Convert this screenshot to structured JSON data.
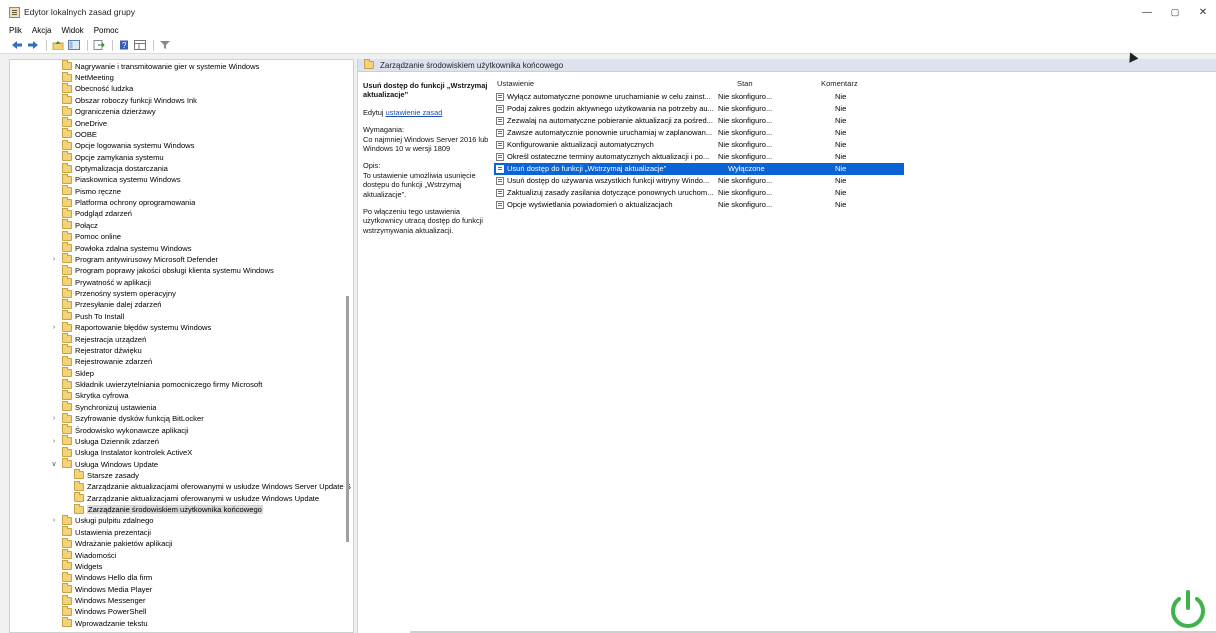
{
  "window": {
    "title": "Edytor lokalnych zasad grupy",
    "controls": [
      "—",
      "▢",
      "✕"
    ]
  },
  "menu": [
    "Plik",
    "Akcja",
    "Widok",
    "Pomoc"
  ],
  "toolbar": {
    "icons": [
      "back-icon",
      "forward-icon",
      "up-folder-icon",
      "show-hide-tree-icon",
      "export-list-icon",
      "help-icon",
      "view-icon",
      "filter-icon"
    ]
  },
  "tree": {
    "items": [
      {
        "label": "Nagrywanie i transmitowanie gier w systemie Windows",
        "level": 1,
        "expander": ""
      },
      {
        "label": "NetMeeting",
        "level": 1,
        "expander": ""
      },
      {
        "label": "Obecność ludzka",
        "level": 1,
        "expander": ""
      },
      {
        "label": "Obszar roboczy funkcji Windows Ink",
        "level": 1,
        "expander": ""
      },
      {
        "label": "Ograniczenia dzierżawy",
        "level": 1,
        "expander": ""
      },
      {
        "label": "OneDrive",
        "level": 1,
        "expander": ""
      },
      {
        "label": "OOBE",
        "level": 1,
        "expander": ""
      },
      {
        "label": "Opcje logowania systemu Windows",
        "level": 1,
        "expander": ""
      },
      {
        "label": "Opcje zamykania systemu",
        "level": 1,
        "expander": ""
      },
      {
        "label": "Optymalizacja dostarczania",
        "level": 1,
        "expander": ""
      },
      {
        "label": "Piaskownica systemu Windows",
        "level": 1,
        "expander": ""
      },
      {
        "label": "Pismo ręczne",
        "level": 1,
        "expander": ""
      },
      {
        "label": "Platforma ochrony oprogramowania",
        "level": 1,
        "expander": ""
      },
      {
        "label": "Podgląd zdarzeń",
        "level": 1,
        "expander": ""
      },
      {
        "label": "Połącz",
        "level": 1,
        "expander": ""
      },
      {
        "label": "Pomoc online",
        "level": 1,
        "expander": ""
      },
      {
        "label": "Powłoka zdalna systemu Windows",
        "level": 1,
        "expander": ""
      },
      {
        "label": "Program antywirusowy Microsoft Defender",
        "level": 1,
        "expander": ">"
      },
      {
        "label": "Program poprawy jakości obsługi klienta systemu Windows",
        "level": 1,
        "expander": ""
      },
      {
        "label": "Prywatność w aplikacji",
        "level": 1,
        "expander": ""
      },
      {
        "label": "Przenośny system operacyjny",
        "level": 1,
        "expander": ""
      },
      {
        "label": "Przesyłanie dalej zdarzeń",
        "level": 1,
        "expander": ""
      },
      {
        "label": "Push To Install",
        "level": 1,
        "expander": ""
      },
      {
        "label": "Raportowanie błędów systemu Windows",
        "level": 1,
        "expander": ">"
      },
      {
        "label": "Rejestracja urządzeń",
        "level": 1,
        "expander": ""
      },
      {
        "label": "Rejestrator dźwięku",
        "level": 1,
        "expander": ""
      },
      {
        "label": "Rejestrowanie zdarzeń",
        "level": 1,
        "expander": ""
      },
      {
        "label": "Sklep",
        "level": 1,
        "expander": ""
      },
      {
        "label": "Składnik uwierzytelniania pomocniczego firmy Microsoft",
        "level": 1,
        "expander": ""
      },
      {
        "label": "Skrytka cyfrowa",
        "level": 1,
        "expander": ""
      },
      {
        "label": "Synchronizuj ustawienia",
        "level": 1,
        "expander": ""
      },
      {
        "label": "Szyfrowanie dysków funkcją BitLocker",
        "level": 1,
        "expander": ">"
      },
      {
        "label": "Środowisko wykonawcze aplikacji",
        "level": 1,
        "expander": ""
      },
      {
        "label": "Usługa Dziennik zdarzeń",
        "level": 1,
        "expander": ">"
      },
      {
        "label": "Usługa Instalator kontrolek ActiveX",
        "level": 1,
        "expander": ""
      },
      {
        "label": "Usługa Windows Update",
        "level": 1,
        "expander": "v"
      },
      {
        "label": "Starsze zasady",
        "level": 2,
        "expander": ""
      },
      {
        "label": "Zarządzanie aktualizacjami oferowanymi w usłudze Windows Server Update S",
        "level": 2,
        "expander": ""
      },
      {
        "label": "Zarządzanie aktualizacjami oferowanymi w usłudze Windows Update",
        "level": 2,
        "expander": ""
      },
      {
        "label": "Zarządzanie środowiskiem użytkownika końcowego",
        "level": 2,
        "expander": "",
        "selected": true
      },
      {
        "label": "Usługi pulpitu zdalnego",
        "level": 1,
        "expander": ">"
      },
      {
        "label": "Ustawienia prezentacji",
        "level": 1,
        "expander": ""
      },
      {
        "label": "Wdrażanie pakietów aplikacji",
        "level": 1,
        "expander": ""
      },
      {
        "label": "Wiadomości",
        "level": 1,
        "expander": ""
      },
      {
        "label": "Widgets",
        "level": 1,
        "expander": ""
      },
      {
        "label": "Windows Hello dla firm",
        "level": 1,
        "expander": ""
      },
      {
        "label": "Windows Media Player",
        "level": 1,
        "expander": ""
      },
      {
        "label": "Windows Messenger",
        "level": 1,
        "expander": ""
      },
      {
        "label": "Windows PowerShell",
        "level": 1,
        "expander": ""
      },
      {
        "label": "Wprowadzanie tekstu",
        "level": 1,
        "expander": ""
      }
    ]
  },
  "right": {
    "header": "Zarządzanie środowiskiem użytkownika końcowego",
    "description": {
      "title": "Usuń dostęp do funkcji „Wstrzymaj aktualizacje”",
      "edit_prefix": "Edytuj",
      "edit_link": "ustawienie zasad",
      "requirements_label": "Wymagania:",
      "requirements_text": "Co najmniej Windows Server 2016 lub Windows 10 w wersji 1809",
      "description_label": "Opis:",
      "description_text": "To ustawienie umożliwia usunięcie dostępu do funkcji „Wstrzymaj aktualizacje”.",
      "extra_text": "Po włączeniu tego ustawienia użytkownicy utracą dostęp do funkcji wstrzymywania aktualizacji."
    },
    "columns": {
      "setting": "Ustawienie",
      "state": "Stan",
      "comment": "Komentarz"
    },
    "rows": [
      {
        "name": "Wyłącz automatyczne ponowne uruchamianie w celu zainst...",
        "state": "Nie skonfiguro...",
        "comment": "Nie"
      },
      {
        "name": "Podaj zakres godzin aktywnego użytkowania na potrzeby au...",
        "state": "Nie skonfiguro...",
        "comment": "Nie"
      },
      {
        "name": "Zezwalaj na automatyczne pobieranie aktualizacji za pośred...",
        "state": "Nie skonfiguro...",
        "comment": "Nie"
      },
      {
        "name": "Zawsze automatycznie ponownie uruchamiaj w zaplanowan...",
        "state": "Nie skonfiguro...",
        "comment": "Nie"
      },
      {
        "name": "Konfigurowanie aktualizacji automatycznych",
        "state": "Nie skonfiguro...",
        "comment": "Nie"
      },
      {
        "name": "Określ ostateczne terminy automatycznych aktualizacji i po...",
        "state": "Nie skonfiguro...",
        "comment": "Nie"
      },
      {
        "name": "Usuń dostęp do funkcji „Wstrzymaj aktualizacje”",
        "state": "Wyłączone",
        "comment": "Nie",
        "selected": true
      },
      {
        "name": "Usuń dostęp do używania wszystkich funkcji witryny Windo...",
        "state": "Nie skonfiguro...",
        "comment": "Nie"
      },
      {
        "name": "Zaktualizuj zasady zasilania dotyczące ponownych uruchom...",
        "state": "Nie skonfiguro...",
        "comment": "Nie"
      },
      {
        "name": "Opcje wyświetlania powiadomień o aktualizacjach",
        "state": "Nie skonfiguro...",
        "comment": "Nie"
      }
    ]
  },
  "colors": {
    "selection": "#0a64d6",
    "header_band": "#dce3ef",
    "logo": "#3fb24b"
  }
}
